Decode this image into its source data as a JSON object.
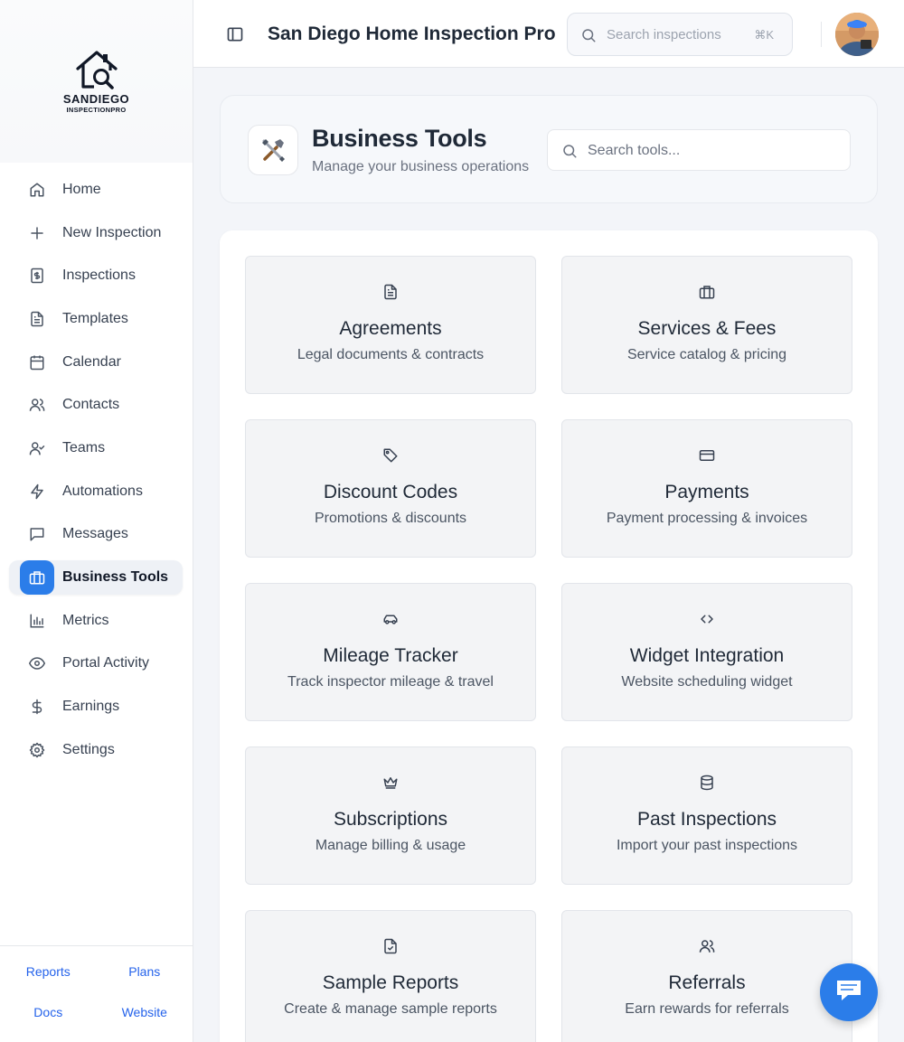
{
  "app": {
    "title": "San Diego Home Inspection Pro",
    "logo_line1": "SANDIEGO",
    "logo_line2": "INSPECTIONPRO"
  },
  "topbar": {
    "search_placeholder": "Search inspections...",
    "search_shortcut": "⌘K"
  },
  "sidebar": {
    "items": [
      {
        "label": "Home",
        "icon": "home-icon"
      },
      {
        "label": "New Inspection",
        "icon": "plus-icon"
      },
      {
        "label": "Inspections",
        "icon": "document-dollar-icon"
      },
      {
        "label": "Templates",
        "icon": "file-text-icon"
      },
      {
        "label": "Calendar",
        "icon": "calendar-icon"
      },
      {
        "label": "Contacts",
        "icon": "users-icon"
      },
      {
        "label": "Teams",
        "icon": "user-check-icon"
      },
      {
        "label": "Automations",
        "icon": "lightning-icon"
      },
      {
        "label": "Messages",
        "icon": "message-icon"
      },
      {
        "label": "Business Tools",
        "icon": "briefcase-icon",
        "active": true
      },
      {
        "label": "Metrics",
        "icon": "bar-chart-icon"
      },
      {
        "label": "Portal Activity",
        "icon": "eye-icon"
      },
      {
        "label": "Earnings",
        "icon": "dollar-icon"
      },
      {
        "label": "Settings",
        "icon": "gear-icon"
      }
    ],
    "footer_links": [
      "Reports",
      "Plans",
      "Docs",
      "Website"
    ]
  },
  "header": {
    "icon": "tools-icon",
    "title": "Business Tools",
    "subtitle": "Manage your business operations",
    "search_placeholder": "Search tools..."
  },
  "tools": [
    {
      "title": "Agreements",
      "description": "Legal documents & contracts",
      "icon": "file-text-icon"
    },
    {
      "title": "Services & Fees",
      "description": "Service catalog & pricing",
      "icon": "briefcase-icon"
    },
    {
      "title": "Discount Codes",
      "description": "Promotions & discounts",
      "icon": "tag-icon"
    },
    {
      "title": "Payments",
      "description": "Payment processing & invoices",
      "icon": "credit-card-icon"
    },
    {
      "title": "Mileage Tracker",
      "description": "Track inspector mileage & travel",
      "icon": "car-icon"
    },
    {
      "title": "Widget Integration",
      "description": "Website scheduling widget",
      "icon": "code-icon"
    },
    {
      "title": "Subscriptions",
      "description": "Manage billing & usage",
      "icon": "crown-icon"
    },
    {
      "title": "Past Inspections",
      "description": "Import your past inspections",
      "icon": "database-icon"
    },
    {
      "title": "Sample Reports",
      "description": "Create & manage sample reports",
      "icon": "file-check-icon"
    },
    {
      "title": "Referrals",
      "description": "Earn rewards for referrals",
      "icon": "users-icon"
    }
  ],
  "colors": {
    "accent": "#2b7de9",
    "link": "#2563eb",
    "card_bg": "#f3f4f6"
  }
}
